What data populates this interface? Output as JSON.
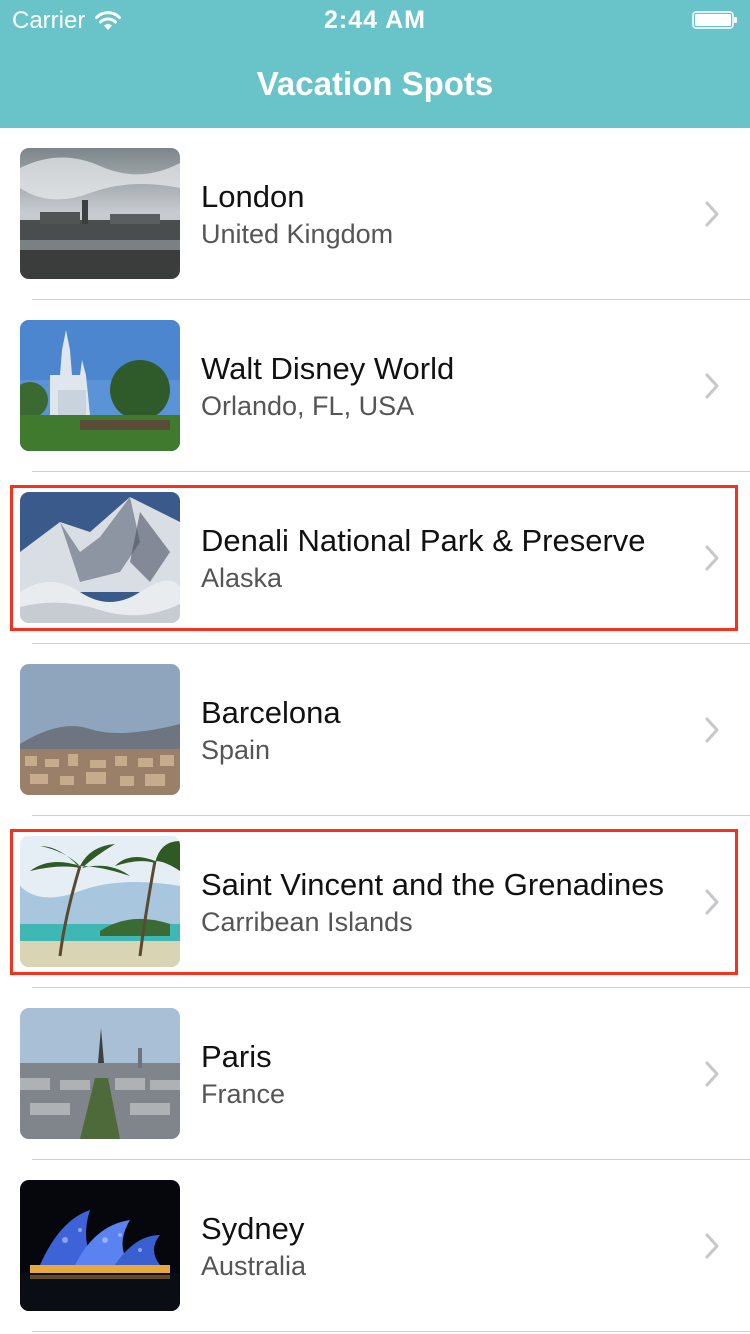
{
  "status_bar": {
    "carrier": "Carrier",
    "time": "2:44 AM",
    "wifi_icon": "wifi-icon",
    "battery_icon": "battery-icon"
  },
  "nav_bar": {
    "title": "Vacation Spots",
    "background_color": "#69C4C9"
  },
  "highlight_color": "#F5321E",
  "spots": [
    {
      "name": "London",
      "location": "United Kingdom",
      "highlighted": false
    },
    {
      "name": "Walt Disney World",
      "location": "Orlando, FL, USA",
      "highlighted": false
    },
    {
      "name": "Denali National Park & Preserve",
      "location": "Alaska",
      "highlighted": true
    },
    {
      "name": "Barcelona",
      "location": "Spain",
      "highlighted": false
    },
    {
      "name": "Saint Vincent and the Grenadines",
      "location": "Carribean Islands",
      "highlighted": true
    },
    {
      "name": "Paris",
      "location": "France",
      "highlighted": false
    },
    {
      "name": "Sydney",
      "location": "Australia",
      "highlighted": false
    }
  ]
}
